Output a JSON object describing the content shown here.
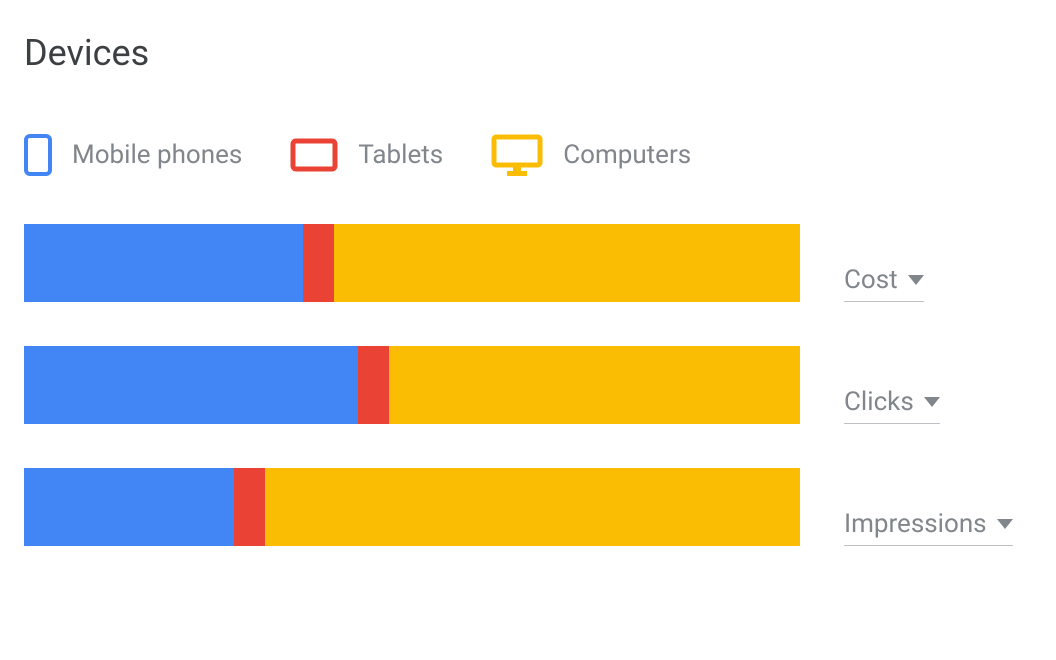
{
  "title": "Devices",
  "legend": {
    "mobile": {
      "label": "Mobile phones",
      "color": "#4285f4"
    },
    "tablet": {
      "label": "Tablets",
      "color": "#ea4335"
    },
    "computer": {
      "label": "Computers",
      "color": "#fbbc04"
    }
  },
  "metrics": {
    "cost": {
      "label": "Cost"
    },
    "clicks": {
      "label": "Clicks"
    },
    "impressions": {
      "label": "Impressions"
    }
  },
  "chart_data": {
    "type": "bar",
    "orientation": "horizontal-stacked",
    "title": "Devices",
    "categories": [
      "Cost",
      "Clicks",
      "Impressions"
    ],
    "series": [
      {
        "name": "Mobile phones",
        "color": "#4285f4",
        "values": [
          36,
          43,
          27
        ]
      },
      {
        "name": "Tablets",
        "color": "#ea4335",
        "values": [
          4,
          4,
          4
        ]
      },
      {
        "name": "Computers",
        "color": "#fbbc04",
        "values": [
          60,
          53,
          69
        ]
      }
    ],
    "unit": "percent",
    "xlabel": "",
    "ylabel": "",
    "xlim": [
      0,
      100
    ]
  }
}
